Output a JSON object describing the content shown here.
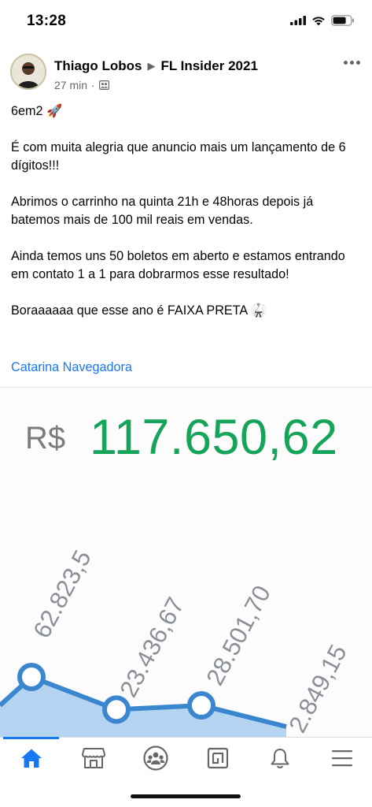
{
  "status": {
    "time": "13:28",
    "icons": [
      "signal-icon",
      "wifi-icon",
      "battery-icon"
    ]
  },
  "post": {
    "author": "Thiago Lobos",
    "group": "FL Insider 2021",
    "time_ago": "27 min",
    "separator": "·",
    "privacy_icon": "members-icon",
    "body": [
      "6em2 🚀",
      "É com muita alegria que anuncio mais um lançamento de 6 dígitos!!!",
      "Abrimos o carrinho na quinta 21h e 48horas depois já batemos mais de 100 mil reais em vendas.",
      "Ainda temos uns 50 boletos em aberto e estamos entrando em contato 1 a 1 para dobrarmos esse resultado!",
      "Boraaaaaa que esse ano é FAIXA PRETA 🥋"
    ],
    "tag": "Catarina Navegadora"
  },
  "image": {
    "currency": "R$",
    "amount": "117.650,62",
    "amount_color": "#16a35a",
    "chart_data": {
      "type": "area",
      "points": [
        {
          "label": "62.823,5",
          "value": 62823.5
        },
        {
          "label": "23.436,67",
          "value": 23436.67
        },
        {
          "label": "28.501,70",
          "value": 28501.7
        },
        {
          "label": "2.849,15",
          "value": 2849.15
        }
      ],
      "line_color": "#3a86cf",
      "fill_color": "#9ec7ee"
    }
  },
  "tabs": [
    {
      "name": "home",
      "icon": "home-icon",
      "active": true
    },
    {
      "name": "marketplace",
      "icon": "marketplace-icon",
      "active": false
    },
    {
      "name": "groups",
      "icon": "groups-icon",
      "active": false
    },
    {
      "name": "pages",
      "icon": "pages-icon",
      "active": false
    },
    {
      "name": "notifications",
      "icon": "bell-icon",
      "active": false
    },
    {
      "name": "menu",
      "icon": "menu-icon",
      "active": false
    }
  ],
  "colors": {
    "accent": "#1877f2",
    "muted": "#65676b"
  }
}
